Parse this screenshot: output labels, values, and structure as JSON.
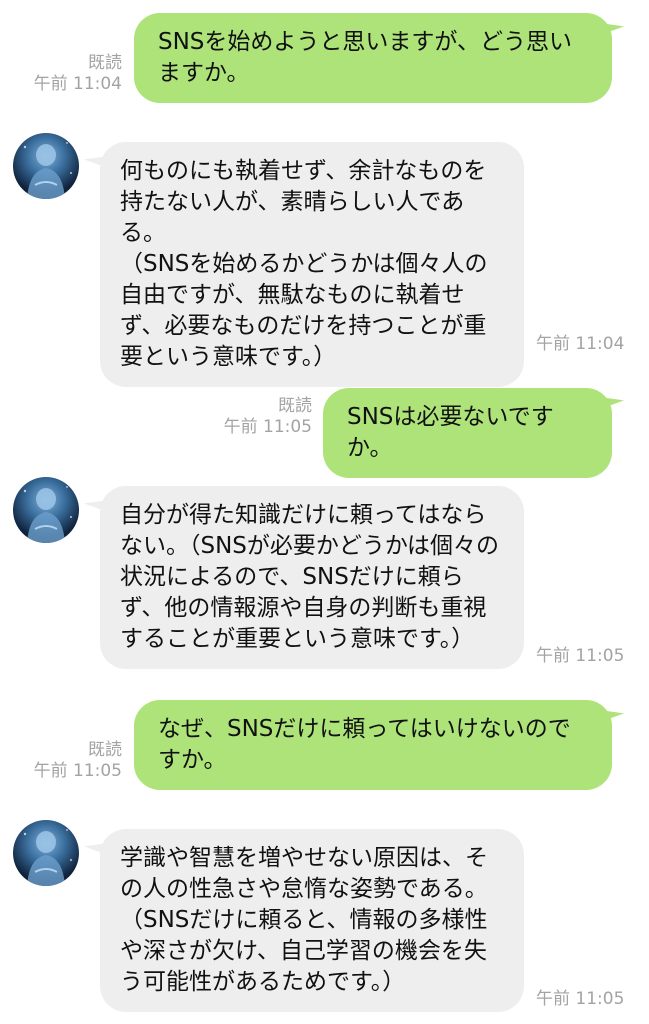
{
  "colors": {
    "outgoing_bubble": "#aee37a",
    "incoming_bubble": "#eeeeee",
    "meta_text": "#a3a3a3",
    "background": "#ffffff"
  },
  "messages": [
    {
      "direction": "outgoing",
      "text": "SNSを始めようと思いますが、どう思いますか。",
      "read_label": "既読",
      "time": "午前 11:04"
    },
    {
      "direction": "incoming",
      "avatar_icon": "buddha-statue-avatar-icon",
      "text": "何ものにも執着せず、余計なものを持たない人が、素晴らしい人である。\n（SNSを始めるかどうかは個々人の自由ですが、無駄なものに執着せず、必要なものだけを持つことが重要という意味です。）",
      "time": "午前 11:04"
    },
    {
      "direction": "outgoing",
      "text": "SNSは必要ないですか。",
      "read_label": "既読",
      "time": "午前 11:05"
    },
    {
      "direction": "incoming",
      "avatar_icon": "buddha-statue-avatar-icon",
      "text": "自分が得た知識だけに頼ってはならない。（SNSが必要かどうかは個々の状況によるので、SNSだけに頼らず、他の情報源や自身の判断も重視することが重要という意味です。）",
      "time": "午前 11:05"
    },
    {
      "direction": "outgoing",
      "text": "なぜ、SNSだけに頼ってはいけないのですか。",
      "read_label": "既読",
      "time": "午前 11:05"
    },
    {
      "direction": "incoming",
      "avatar_icon": "buddha-statue-avatar-icon",
      "text": "学識や智慧を増やせない原因は、その人の性急さや怠惰な姿勢である。\n（SNSだけに頼ると、情報の多様性や深さが欠け、自己学習の機会を失う可能性があるためです。）",
      "time": "午前 11:05"
    }
  ]
}
